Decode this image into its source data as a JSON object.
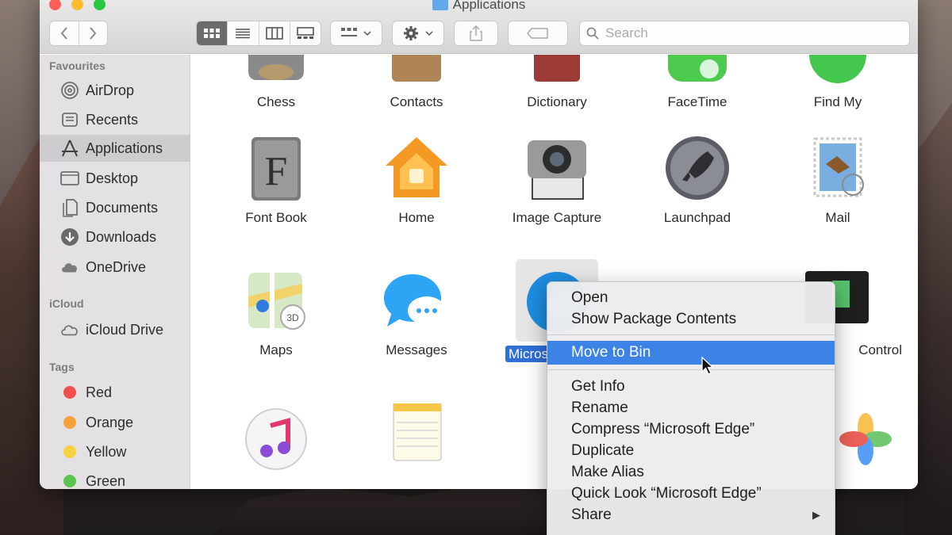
{
  "window": {
    "title": "Applications"
  },
  "toolbar": {
    "back_icon": "chevron-left-icon",
    "forward_icon": "chevron-right-icon",
    "view_modes": [
      "icon-view",
      "list-view",
      "column-view",
      "gallery-view"
    ],
    "active_view": "icon-view",
    "search_placeholder": "Search"
  },
  "sidebar": {
    "favourites_title": "Favourites",
    "favourites": [
      {
        "label": "AirDrop",
        "icon": "airdrop-icon"
      },
      {
        "label": "Recents",
        "icon": "recents-icon"
      },
      {
        "label": "Applications",
        "icon": "applications-icon",
        "selected": true
      },
      {
        "label": "Desktop",
        "icon": "desktop-icon"
      },
      {
        "label": "Documents",
        "icon": "documents-icon"
      },
      {
        "label": "Downloads",
        "icon": "downloads-icon"
      },
      {
        "label": "OneDrive",
        "icon": "cloud-icon"
      }
    ],
    "icloud_title": "iCloud",
    "icloud": [
      {
        "label": "iCloud Drive",
        "icon": "cloud-icon"
      }
    ],
    "tags_title": "Tags",
    "tags": [
      {
        "label": "Red",
        "color": "#f0504b"
      },
      {
        "label": "Orange",
        "color": "#f6a13c"
      },
      {
        "label": "Yellow",
        "color": "#f7d23e"
      },
      {
        "label": "Green",
        "color": "#5cc550"
      }
    ]
  },
  "apps": {
    "row1": [
      "Chess",
      "Contacts",
      "Dictionary",
      "FaceTime",
      "Find My"
    ],
    "row2": [
      "Font Book",
      "Home",
      "Image Capture",
      "Launchpad",
      "Mail"
    ],
    "row3": [
      "Maps",
      "Messages",
      "Micros",
      "",
      "Control"
    ],
    "selected_app": "Micros"
  },
  "context_menu": {
    "group1": [
      "Open",
      "Show Package Contents"
    ],
    "highlighted": "Move to Bin",
    "group2": [
      "Get Info",
      "Rename",
      "Compress “Microsoft Edge”",
      "Duplicate",
      "Make Alias",
      "Quick Look “Microsoft Edge”",
      "Share"
    ]
  },
  "colors": {
    "highlight": "#3c83e5",
    "folder": "#62a8ea",
    "sidebar_bg": "#e3e1e3"
  }
}
